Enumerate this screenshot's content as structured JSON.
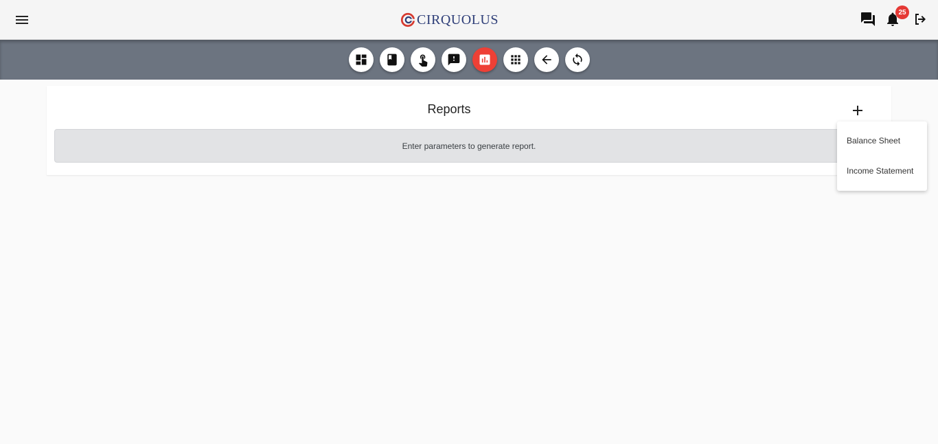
{
  "app": {
    "brand": "CIRQUOLUS",
    "brand_color": "#2e3e78",
    "accent_color": "#ee4036"
  },
  "header": {
    "menu_icon": "hamburger-menu-icon",
    "icons": [
      "chat-icon",
      "bell-icon",
      "logout-icon"
    ],
    "notification_count": "25"
  },
  "toolbar": {
    "buttons": [
      {
        "icon": "dashboard-icon",
        "active": false
      },
      {
        "icon": "book-icon",
        "active": false
      },
      {
        "icon": "touch-icon",
        "active": false
      },
      {
        "icon": "feedback-icon",
        "active": false
      },
      {
        "icon": "bar-chart-icon",
        "active": true
      },
      {
        "icon": "apps-grid-icon",
        "active": false
      },
      {
        "icon": "arrow-back-icon",
        "active": false
      },
      {
        "icon": "sync-icon",
        "active": false
      }
    ]
  },
  "main": {
    "title": "Reports",
    "add_icon": "plus-icon",
    "notice": "Enter parameters to generate report."
  },
  "dropdown": {
    "items": [
      "Balance Sheet",
      "Income Statement"
    ]
  }
}
